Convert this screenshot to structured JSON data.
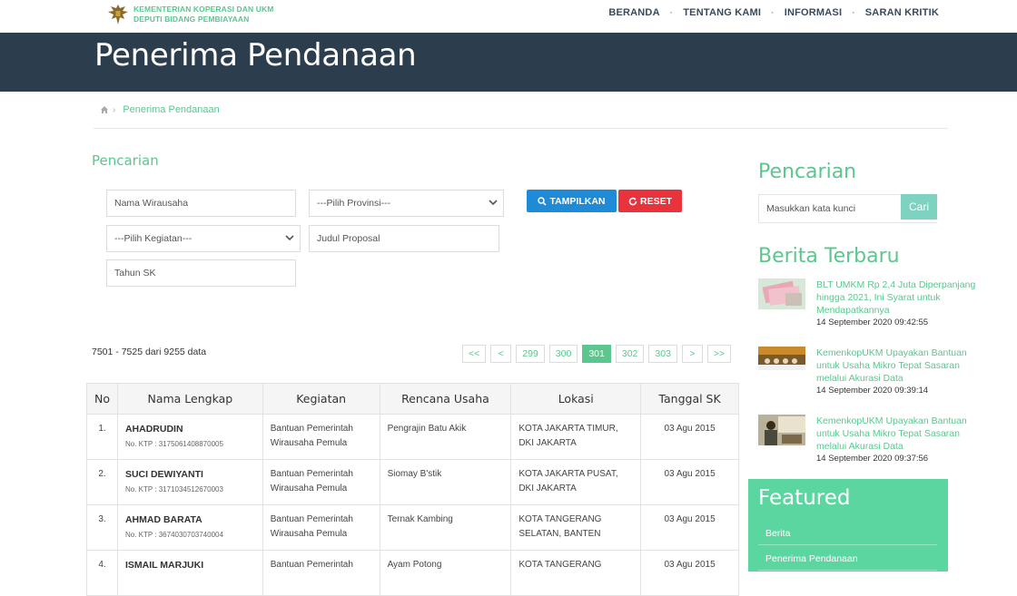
{
  "header": {
    "ministry_line1": "KEMENTERIAN KOPERASI DAN UKM",
    "ministry_line2": "DEPUTI BIDANG PEMBIAYAAN",
    "nav": [
      "BERANDA",
      "TENTANG KAMI",
      "INFORMASI",
      "SARAN KRITIK"
    ]
  },
  "page_title": "Penerima Pendanaan",
  "breadcrumb": {
    "current": "Penerima Pendanaan"
  },
  "search_form": {
    "title": "Pencarian",
    "nama_placeholder": "Nama Wirausaha",
    "provinsi_placeholder": "---Pilih Provinsi---",
    "kegiatan_placeholder": "---Pilih Kegiatan---",
    "judul_placeholder": "Judul Proposal",
    "tahun_placeholder": "Tahun SK",
    "btn_show": "TAMPILKAN",
    "btn_reset": "RESET"
  },
  "results": {
    "count_text": "7501 - 7525 dari 9255 data",
    "pages": [
      "<<",
      "<",
      "299",
      "300",
      "301",
      "302",
      "303",
      ">",
      ">>"
    ],
    "active_page": "301"
  },
  "table": {
    "headers": [
      "No",
      "Nama Lengkap",
      "Kegiatan",
      "Rencana Usaha",
      "Lokasi",
      "Tanggal SK"
    ],
    "rows": [
      {
        "no": "1.",
        "name": "AHADRUDIN",
        "ktp": "No. KTP : 3175061408870005",
        "kegiatan": "Bantuan Pemerintah Wirausaha Pemula",
        "usaha": "Pengrajin Batu Akik",
        "lokasi": "KOTA JAKARTA TIMUR, DKI JAKARTA",
        "tanggal": "03 Agu 2015"
      },
      {
        "no": "2.",
        "name": "SUCI DEWIYANTI",
        "ktp": "No. KTP : 3171034512670003",
        "kegiatan": "Bantuan Pemerintah Wirausaha Pemula",
        "usaha": "Siomay B'stik",
        "lokasi": "KOTA JAKARTA PUSAT, DKI JAKARTA",
        "tanggal": "03 Agu 2015"
      },
      {
        "no": "3.",
        "name": "AHMAD BARATA",
        "ktp": "No. KTP : 3674030703740004",
        "kegiatan": "Bantuan Pemerintah Wirausaha Pemula",
        "usaha": "Ternak Kambing",
        "lokasi": "KOTA TANGERANG SELATAN, BANTEN",
        "tanggal": "03 Agu 2015"
      },
      {
        "no": "4.",
        "name": "ISMAIL MARJUKI",
        "ktp": "",
        "kegiatan": "Bantuan Pemerintah",
        "usaha": "Ayam Potong",
        "lokasi": "KOTA TANGERANG",
        "tanggal": "03 Agu 2015"
      }
    ]
  },
  "sidebar": {
    "search_title": "Pencarian",
    "search_placeholder": "Masukkan kata kunci",
    "search_button": "Cari",
    "news_title": "Berita Terbaru",
    "news": [
      {
        "headline": "BLT UMKM Rp 2,4 Juta Diperpanjang hingga 2021, Ini Syarat untuk Mendapatkannya",
        "time": "14 September 2020 09:42:55"
      },
      {
        "headline": "KemenkopUKM Upayakan Bantuan untuk Usaha Mikro Tepat Sasaran melalui Akurasi Data",
        "time": "14 September 2020 09:39:14"
      },
      {
        "headline": "KemenkopUKM Upayakan Bantuan untuk Usaha Mikro Tepat Sasaran melalui Akurasi Data",
        "time": "14 September 2020 09:37:56"
      }
    ],
    "featured_title": "Featured",
    "featured_items": [
      "Berita",
      "Penerima Pendanaan"
    ]
  },
  "colors": {
    "accent": "#5cc68f",
    "band": "#2c3e4e",
    "primary_btn": "#1f8ad6",
    "danger_btn": "#e8323c",
    "featured_bg": "#5cd6a0"
  }
}
